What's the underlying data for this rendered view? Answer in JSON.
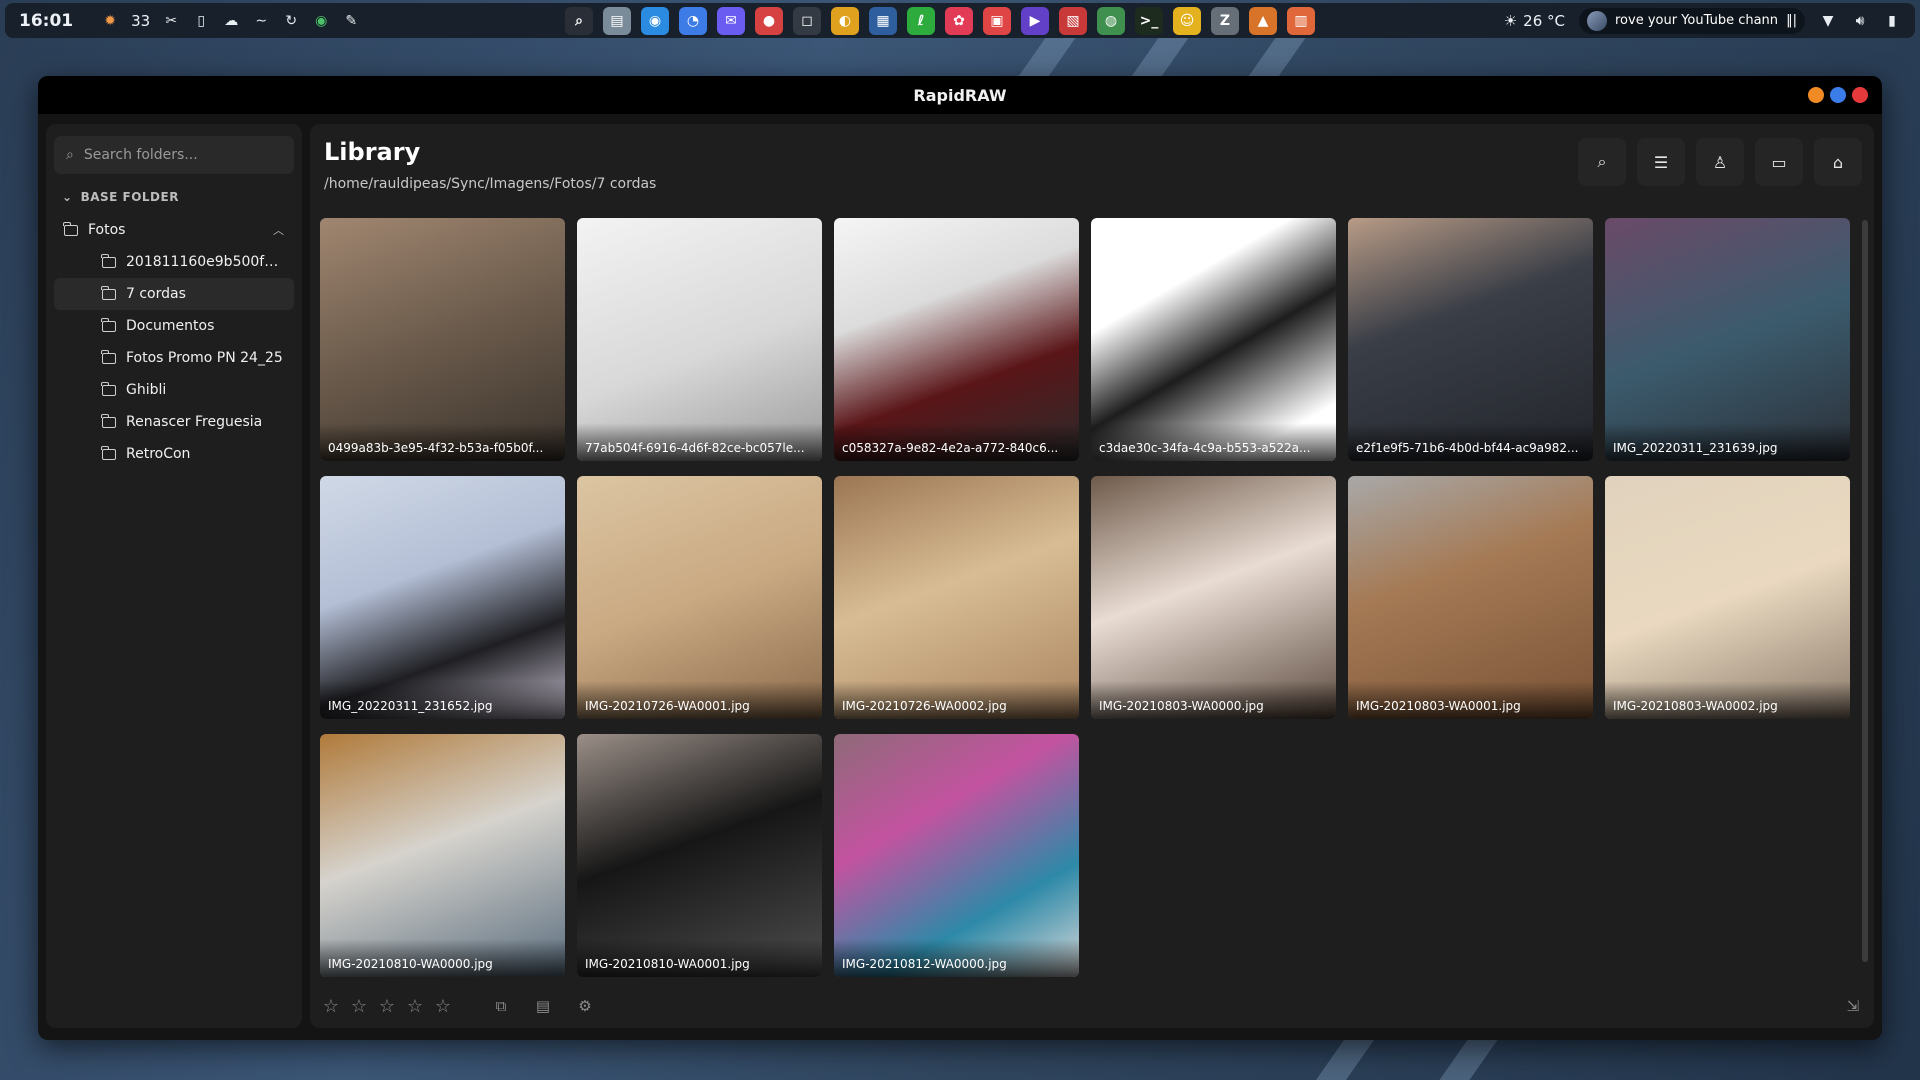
{
  "topbar": {
    "clock": "16:01",
    "tray_count": "33",
    "weather": "26 °C",
    "media_title": "rove your YouTube chann",
    "tray_icons": [
      "alert-icon",
      "tools-icon",
      "phone-icon",
      "cloud-icon",
      "wave-icon",
      "sync-icon",
      "vpn-icon",
      "bug-icon"
    ],
    "apps": [
      {
        "name": "search-app-icon",
        "color": "#2a2f37",
        "glyph": "⌕"
      },
      {
        "name": "files-app-icon",
        "color": "#7a8b99",
        "glyph": "▤"
      },
      {
        "name": "browser-app-icon",
        "color": "#2a8be0",
        "glyph": "◉"
      },
      {
        "name": "firefox-app-icon",
        "color": "#3d7be6",
        "glyph": "◔"
      },
      {
        "name": "messenger-app-icon",
        "color": "#6a5cf0",
        "glyph": "✉"
      },
      {
        "name": "chat-app-icon",
        "color": "#d64141",
        "glyph": "●"
      },
      {
        "name": "notes-app-icon",
        "color": "#333a44",
        "glyph": "◻"
      },
      {
        "name": "chrome-app-icon",
        "color": "#e0a21e",
        "glyph": "◐"
      },
      {
        "name": "palette-app-icon",
        "color": "#2f5e9e",
        "glyph": "▦"
      },
      {
        "name": "editor-app-icon",
        "color": "#2dab3d",
        "glyph": "ℓ"
      },
      {
        "name": "color-app-icon",
        "color": "#e23b55",
        "glyph": "✿"
      },
      {
        "name": "tasks-app-icon",
        "color": "#e04545",
        "glyph": "▣"
      },
      {
        "name": "video-app-icon",
        "color": "#6240c8",
        "glyph": "▶"
      },
      {
        "name": "docs-app-icon",
        "color": "#c83a3a",
        "glyph": "▧"
      },
      {
        "name": "vpn-app-icon",
        "color": "#3f8f4f",
        "glyph": "◍"
      },
      {
        "name": "terminal-app-icon",
        "color": "#1c2b1d",
        "glyph": ">_"
      },
      {
        "name": "emoji-app-icon",
        "color": "#e5b21f",
        "glyph": "☺"
      },
      {
        "name": "zed-app-icon",
        "color": "#666e78",
        "glyph": "Z"
      },
      {
        "name": "rapidraw-app-icon",
        "color": "#d7742a",
        "glyph": "▲"
      },
      {
        "name": "photos-app-icon",
        "color": "#e0673a",
        "glyph": "▥"
      }
    ]
  },
  "window": {
    "title": "RapidRAW",
    "controls": [
      "#f08a24",
      "#3b7de8",
      "#e5393b"
    ]
  },
  "sidebar": {
    "search_placeholder": "Search folders...",
    "base_folder_label": "BASE FOLDER",
    "root": "Fotos",
    "items": [
      "201811160e9b500f23f5...",
      "7 cordas",
      "Documentos",
      "Fotos Promo PN 24_25",
      "Ghibli",
      "Renascer Freguesia",
      "RetroCon"
    ],
    "active_index": 1
  },
  "main": {
    "title": "Library",
    "path": "/home/rauldipeas/Sync/Imagens/Fotos/7 cordas",
    "actions": [
      "search-icon",
      "sliders-icon",
      "people-icon",
      "folder-icon",
      "home-icon"
    ]
  },
  "images": [
    {
      "name": "0499a83b-3e95-4f32-b53a-f05b0f...",
      "bg": "linear-gradient(160deg,#a08670 0%,#6a5a4b 50%,#3a332c 100%)"
    },
    {
      "name": "77ab504f-6916-4d6f-82ce-bc057le...",
      "bg": "linear-gradient(160deg,#f3f3f3 0%,#d8d8d8 55%,#9a9a9a 100%)"
    },
    {
      "name": "c058327a-9e82-4e2a-a772-840c6...",
      "bg": "linear-gradient(160deg,#f5f5f5 0%,#dcdcdc 35%,#5a1518 65%,#2c2c2c 100%)"
    },
    {
      "name": "c3dae30c-34fa-4c9a-b553-a522a...",
      "bg": "linear-gradient(150deg,#ffffff 0%,#ffffff 30%,#1d1d1d 55%,#ffffff 85%)"
    },
    {
      "name": "e2f1e9f5-71b6-4b0d-bf44-ac9a982...",
      "bg": "linear-gradient(160deg,#b89b86 0%,#3a3e47 40%,#22252b 100%)"
    },
    {
      "name": "IMG_20220311_231639.jpg",
      "bg": "linear-gradient(160deg,#6a4a68 0%,#3b5b6d 50%,#2b3038 100%)"
    },
    {
      "name": "IMG_20220311_231652.jpg",
      "bg": "linear-gradient(160deg,#cfd9e6 0%,#b4bfd6 40%,#1f1f23 70%,#c9c2d2 100%)"
    },
    {
      "name": "IMG-20210726-WA0001.jpg",
      "bg": "linear-gradient(160deg,#dcc5a2 0%,#c9a982 50%,#8c6b4c 100%)"
    },
    {
      "name": "IMG-20210726-WA0002.jpg",
      "bg": "linear-gradient(160deg,#9c7654 0%,#d8bd94 45%,#a98460 100%)"
    },
    {
      "name": "IMG-20210803-WA0000.jpg",
      "bg": "linear-gradient(160deg,#6e5a4a 0%,#e9dcd3 45%,#5b4a3e 100%)"
    },
    {
      "name": "IMG-20210803-WA0001.jpg",
      "bg": "linear-gradient(160deg,#a8a8a8 0%,#a57a55 40%,#7a5336 100%)"
    },
    {
      "name": "IMG-20210803-WA0002.jpg",
      "bg": "linear-gradient(160deg,#e0d2bd 0%,#ead9c0 50%,#8a7a6a 100%)"
    },
    {
      "name": "IMG-20210810-WA0000.jpg",
      "bg": "linear-gradient(160deg,#b07a3a 0%,#d6d3cd 45%,#5a6d7e 100%)"
    },
    {
      "name": "IMG-20210810-WA0001.jpg",
      "bg": "linear-gradient(160deg,#9b8f88 0%,#161616 45%,#4d4d4d 100%)"
    },
    {
      "name": "IMG-20210812-WA0000.jpg",
      "bg": "linear-gradient(150deg,#8e6a78 0%,#c353a0 35%,#2d89a8 70%,#d9d9d9 100%)"
    }
  ]
}
